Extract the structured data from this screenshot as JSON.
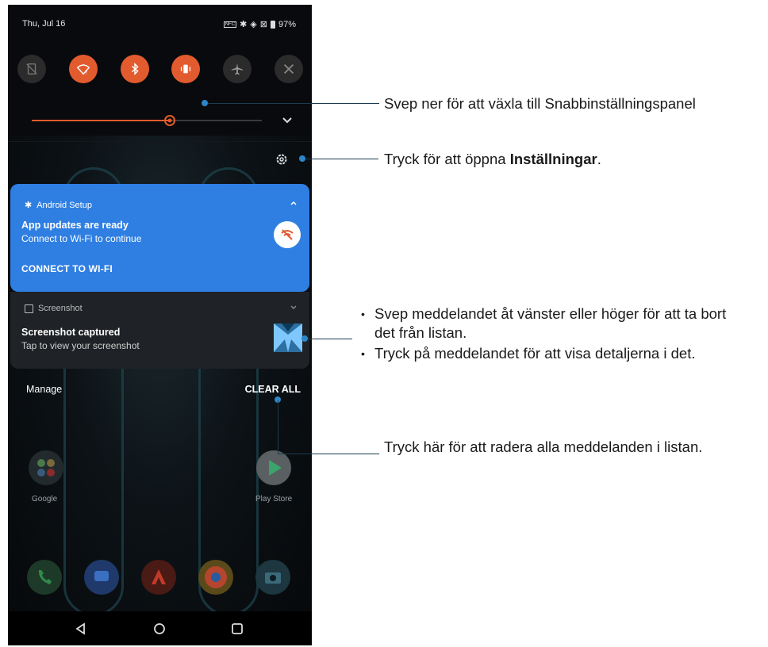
{
  "status_bar": {
    "date": "Thu, Jul 16",
    "battery": "97%",
    "icons": [
      "nfc-icon",
      "bluetooth-icon",
      "vibrate-icon",
      "no-sim-icon",
      "battery-icon"
    ]
  },
  "quick_settings": [
    {
      "name": "no-sim",
      "icon": "no-sim-icon",
      "active": false
    },
    {
      "name": "wifi",
      "icon": "wifi-question-icon",
      "active": true
    },
    {
      "name": "bluetooth",
      "icon": "bluetooth-icon",
      "active": true
    },
    {
      "name": "vibrate",
      "icon": "vibrate-icon",
      "active": true
    },
    {
      "name": "airplane",
      "icon": "airplane-icon",
      "active": false
    },
    {
      "name": "x-mode",
      "icon": "x-mode-icon",
      "active": false
    }
  ],
  "brightness": {
    "level": 0.6
  },
  "notifications": [
    {
      "app": "Android Setup",
      "title": "App updates are ready",
      "body": "Connect to Wi-Fi to continue",
      "action": "CONNECT TO WI-FI",
      "color": "#2f7fe3"
    },
    {
      "app": "Screenshot",
      "title": "Screenshot captured",
      "body": "Tap to view your screenshot"
    }
  ],
  "footer": {
    "manage": "Manage",
    "clear_all": "CLEAR ALL"
  },
  "home_apps": [
    {
      "label": "Google",
      "icon": "google-folder-icon"
    },
    {
      "label": "Play Store",
      "icon": "play-store-icon"
    }
  ],
  "dock": [
    "phone-icon",
    "messages-icon",
    "armoury-icon",
    "chrome-icon",
    "camera-icon"
  ],
  "nav": [
    "back-icon",
    "home-icon",
    "recents-icon"
  ],
  "annotations": {
    "swipe_down": "Svep ner för att växla till Snabbinställningspanel",
    "settings_prefix": "Tryck för att öppna ",
    "settings_bold": "Inställningar",
    "settings_suffix": ".",
    "bullet_1": "Svep meddelandet åt vänster eller höger för att ta bort det från listan.",
    "bullet_2": "Tryck på meddelandet för att visa detaljerna i det.",
    "clear_all": "Tryck här för att radera alla meddelanden i listan."
  },
  "colors": {
    "accent": "#e25b2e",
    "notification_blue": "#2f7fe3",
    "annotation_dot": "#2e86c8"
  }
}
